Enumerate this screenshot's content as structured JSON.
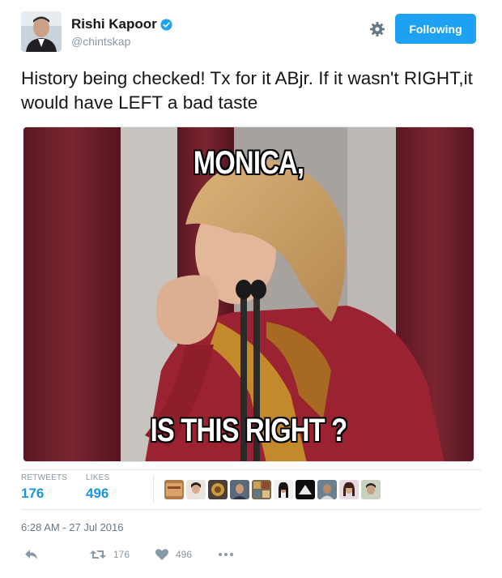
{
  "user": {
    "display_name": "Rishi Kapoor",
    "handle": "@chintskap",
    "verified": true,
    "avatar_icon": "avatar-photo-icon"
  },
  "follow_button": {
    "label": "Following",
    "color": "#1da1f2"
  },
  "settings_icon": "gear-icon",
  "tweet": {
    "text": "History being checked! Tx for it ABjr. If it wasn't RIGHT,it would have LEFT a bad taste"
  },
  "media": {
    "caption_top": "MONICA,",
    "caption_bottom": "IS THIS RIGHT ?"
  },
  "stats": {
    "retweets_label": "RETWEETS",
    "retweets_value": "176",
    "likes_label": "LIKES",
    "likes_value": "496",
    "value_color": "#1b95e0"
  },
  "likers": [
    "liker-avatar-1",
    "liker-avatar-2",
    "liker-avatar-3",
    "liker-avatar-4",
    "liker-avatar-5",
    "liker-avatar-6",
    "liker-avatar-7",
    "liker-avatar-8",
    "liker-avatar-9",
    "liker-avatar-10"
  ],
  "timestamp": "6:28 AM - 27 Jul 2016",
  "actions": {
    "reply_icon": "reply-icon",
    "retweet_icon": "retweet-icon",
    "retweet_count": "176",
    "like_icon": "heart-icon",
    "like_count": "496",
    "more_icon": "more-dots-icon"
  }
}
